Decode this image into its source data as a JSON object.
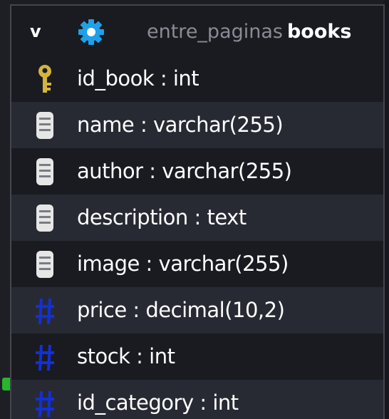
{
  "table": {
    "collapse_label": "v",
    "schema": "entre_paginas",
    "name": "books",
    "columns": [
      {
        "label": "id_book : int",
        "icon": "key-icon"
      },
      {
        "label": "name : varchar(255)",
        "icon": "field-icon"
      },
      {
        "label": "author : varchar(255)",
        "icon": "field-icon"
      },
      {
        "label": "description : text",
        "icon": "field-icon"
      },
      {
        "label": "image : varchar(255)",
        "icon": "field-icon"
      },
      {
        "label": "price : decimal(10,2)",
        "icon": "hash-icon"
      },
      {
        "label": "stock : int",
        "icon": "hash-icon"
      },
      {
        "label": "id_category : int",
        "icon": "hash-icon"
      }
    ]
  },
  "colors": {
    "background": "#1a1b21",
    "alt_row": "#282a33",
    "gear": "#1fa0e8",
    "key": "#d4b43a",
    "field_icon": "#e6e6e6",
    "hash": "#1230d8",
    "connector": "#27b52b"
  }
}
